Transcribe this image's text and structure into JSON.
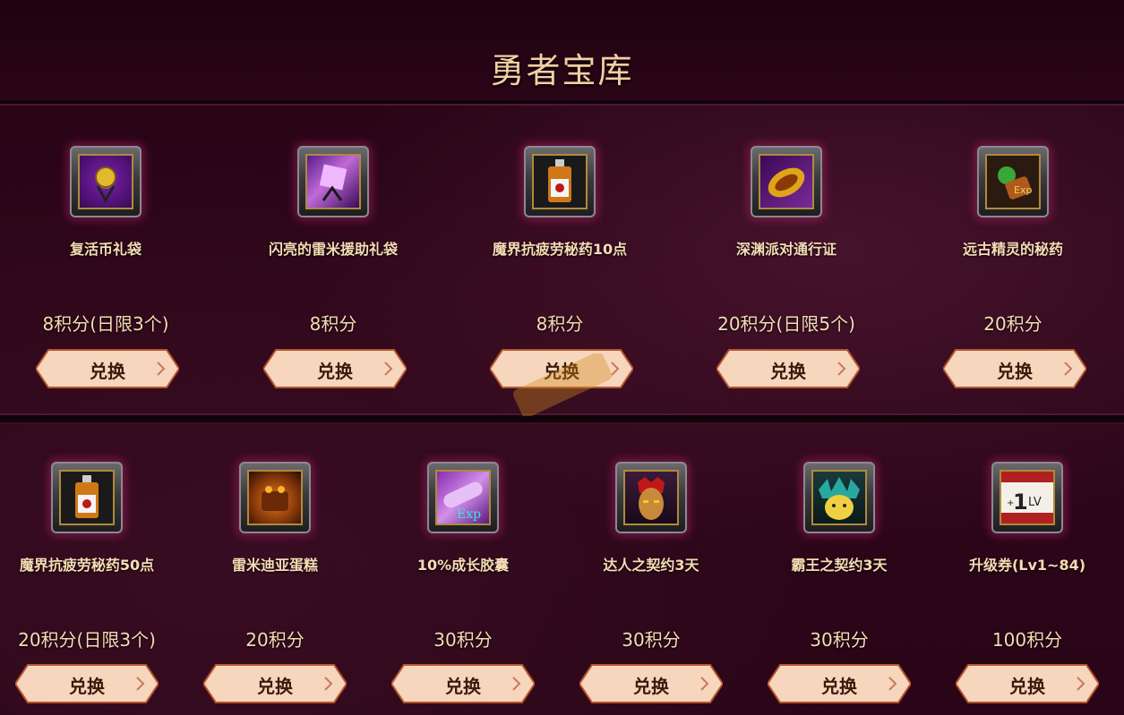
{
  "page": {
    "title": "勇者宝库"
  },
  "row1": [
    {
      "name": "复活币礼袋",
      "price": "8积分(日限3个)",
      "button": "兑换",
      "icon": "revive-coin-bag-icon"
    },
    {
      "name": "闪亮的雷米援助礼袋",
      "price": "8积分",
      "button": "兑换",
      "icon": "remy-aid-bag-icon"
    },
    {
      "name": "魔界抗疲劳秘药10点",
      "price": "8积分",
      "button": "兑换",
      "icon": "fatigue-potion-icon"
    },
    {
      "name": "深渊派对通行证",
      "price": "20积分(日限5个)",
      "button": "兑换",
      "icon": "abyss-pass-icon"
    },
    {
      "name": "远古精灵的秘药",
      "price": "20积分",
      "button": "兑换",
      "icon": "ancient-elf-potion-icon"
    }
  ],
  "row2": [
    {
      "name": "魔界抗疲劳秘药50点",
      "price": "20积分(日限3个)",
      "button": "兑换",
      "icon": "fatigue-potion-icon"
    },
    {
      "name": "雷米迪亚蛋糕",
      "price": "20积分",
      "button": "兑换",
      "icon": "remydia-cake-icon"
    },
    {
      "name": "10%成长胶囊",
      "price": "30积分",
      "button": "兑换",
      "icon": "exp-capsule-icon"
    },
    {
      "name": "达人之契约3天",
      "price": "30积分",
      "button": "兑换",
      "icon": "master-contract-icon"
    },
    {
      "name": "霸王之契约3天",
      "price": "30积分",
      "button": "兑换",
      "icon": "overlord-contract-icon"
    },
    {
      "name": "升级券(Lv1~84)",
      "price": "100积分",
      "button": "兑换",
      "icon": "level-up-ticket-icon"
    }
  ],
  "colors": {
    "background": "#2a0518",
    "text": "#f6dcb5",
    "title": "#f2cfa3",
    "button": "#f5d3b8"
  }
}
